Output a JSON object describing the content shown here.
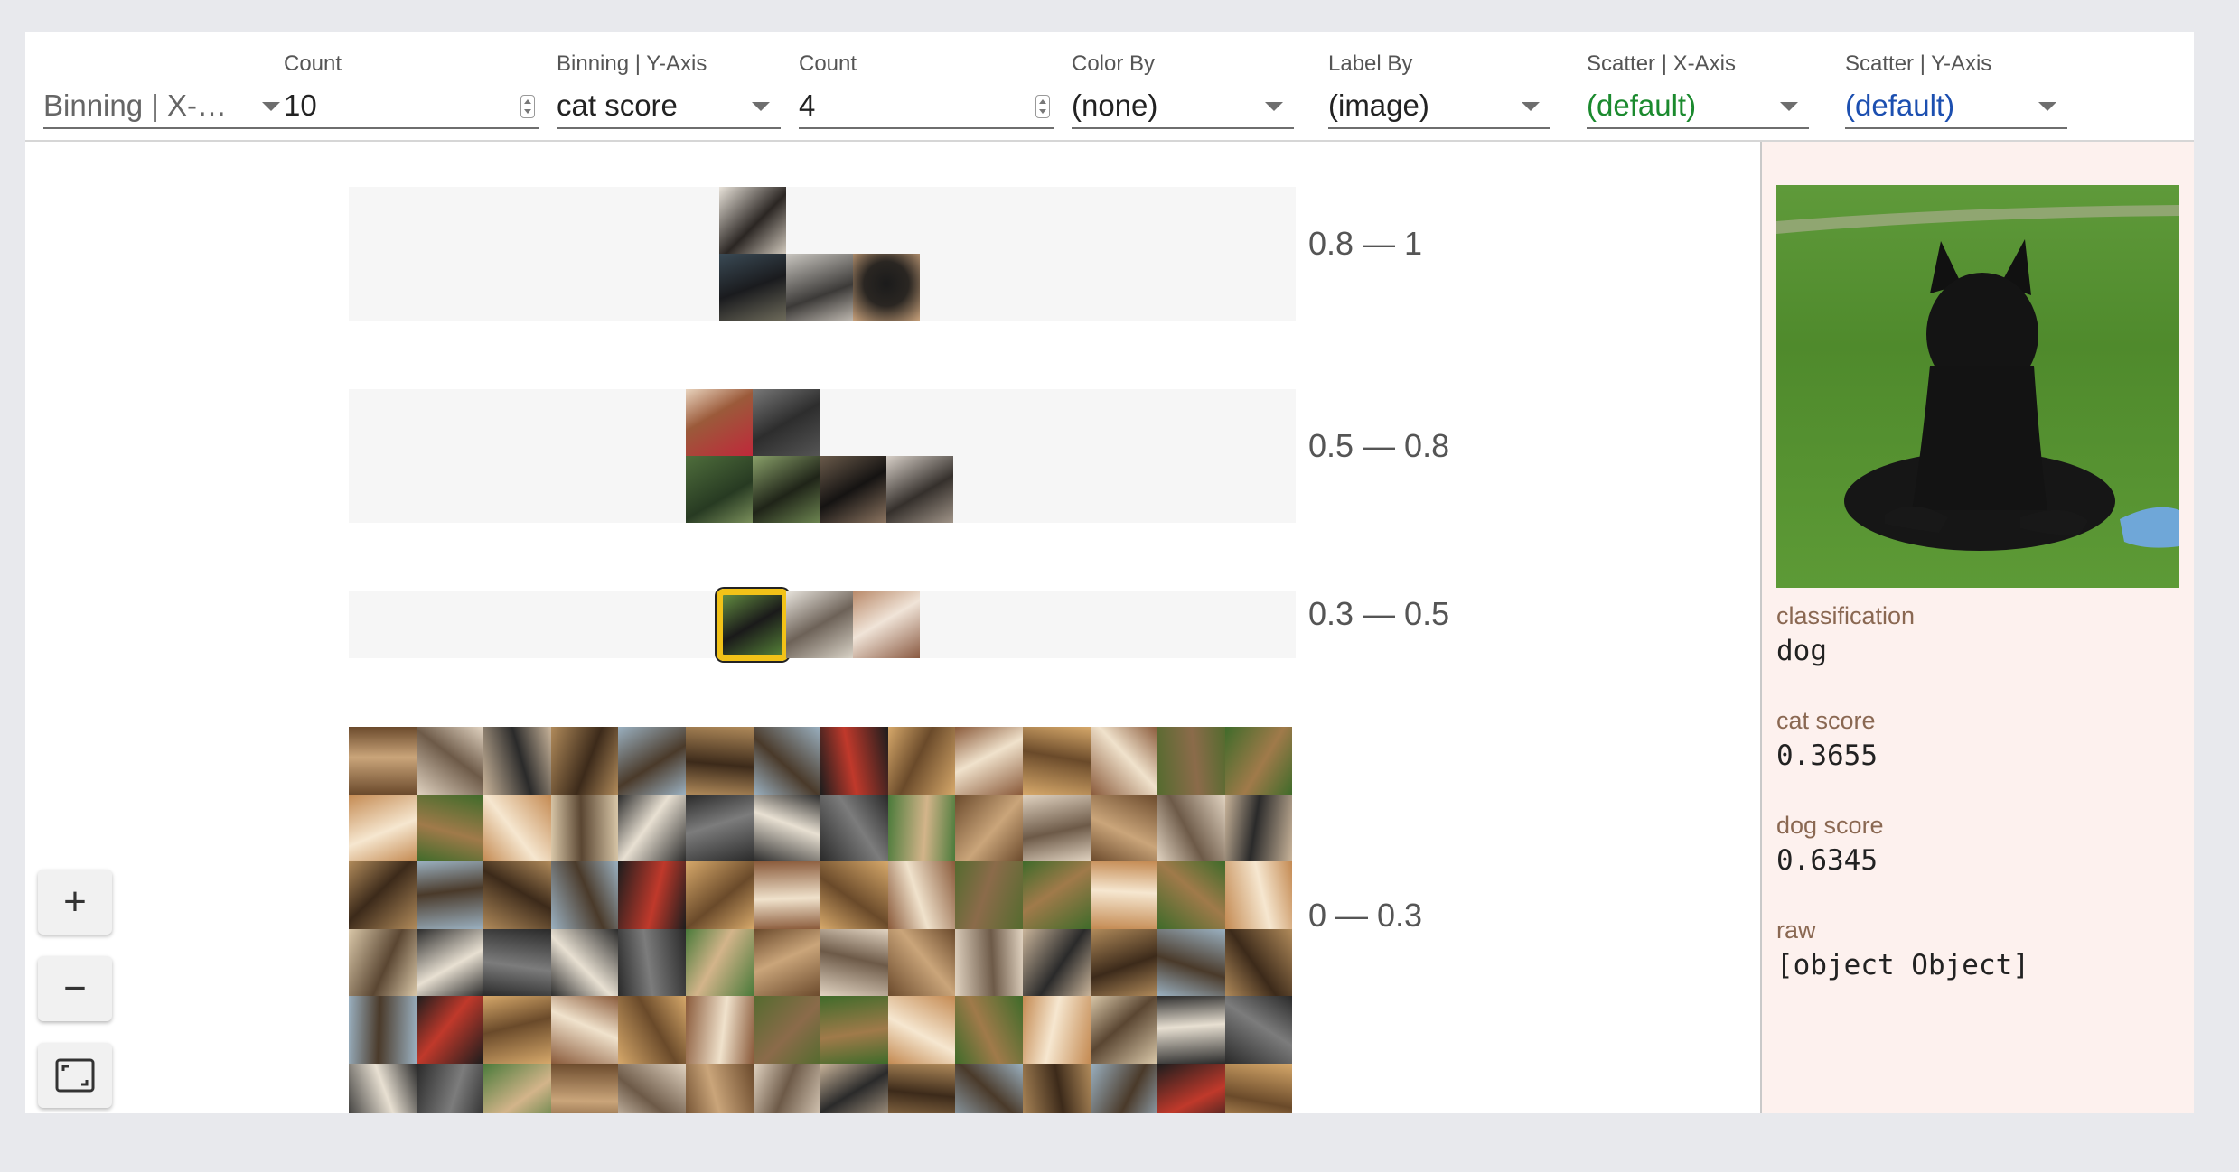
{
  "toolbar": {
    "binning_x": {
      "value": "Binning | X-…"
    },
    "count_x": {
      "label": "Count",
      "value": "10"
    },
    "binning_y": {
      "label": "Binning | Y-Axis",
      "value": "cat score"
    },
    "count_y": {
      "label": "Count",
      "value": "4"
    },
    "color_by": {
      "label": "Color By",
      "value": "(none)"
    },
    "label_by": {
      "label": "Label By",
      "value": "(image)"
    },
    "scatter_x": {
      "label": "Scatter | X-Axis",
      "value": "(default)"
    },
    "scatter_y": {
      "label": "Scatter | Y-Axis",
      "value": "(default)"
    }
  },
  "bins": [
    {
      "label": "0.8 — 1",
      "count": 4
    },
    {
      "label": "0.5 — 0.8",
      "count": 6
    },
    {
      "label": "0.3 — 0.5",
      "count": 3
    },
    {
      "label": "0 — 0.3",
      "count": 84
    }
  ],
  "zoom": {
    "in": "+",
    "out": "−"
  },
  "details": {
    "classification_key": "classification",
    "classification_val": "dog",
    "cat_score_key": "cat score",
    "cat_score_val": "0.3655",
    "dog_score_key": "dog score",
    "dog_score_val": "0.6345",
    "raw_key": "raw",
    "raw_val": "[object Object]"
  },
  "colors": {
    "selection": "#f2c218",
    "side_panel_bg": "#fdf1ee",
    "label_by_green": "#1b8a2e",
    "scatter_y_blue": "#1c4fb0"
  }
}
